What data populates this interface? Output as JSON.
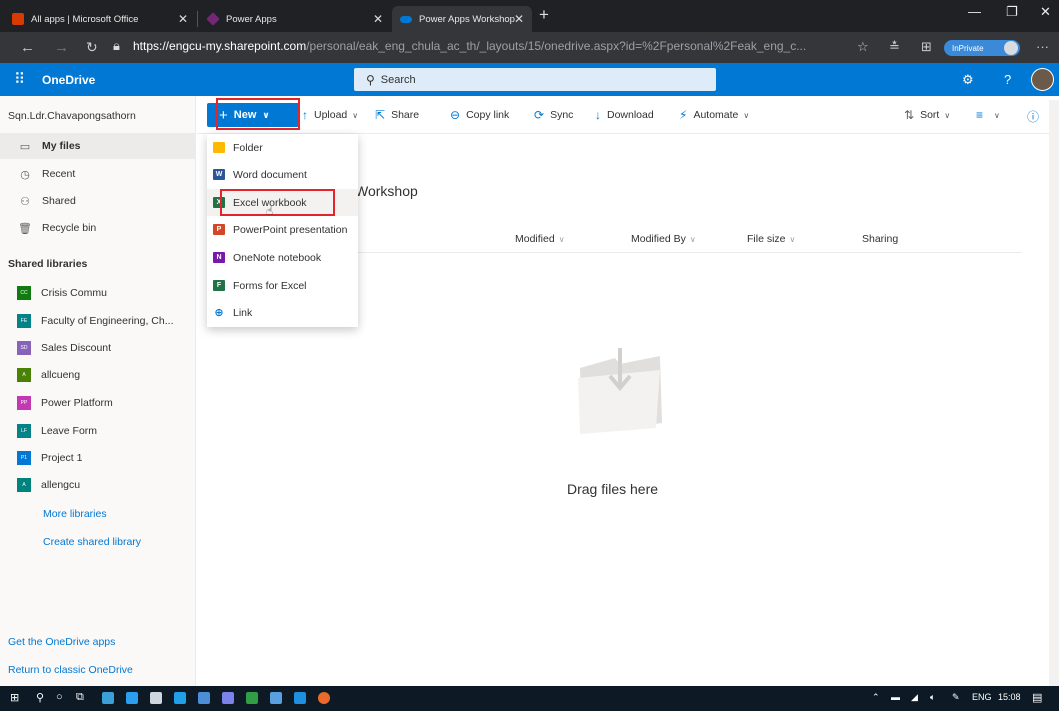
{
  "browser": {
    "tabs": [
      {
        "title": "All apps | Microsoft Office",
        "icon": "office-icon",
        "color": "#d83b01"
      },
      {
        "title": "Power Apps",
        "icon": "powerapps-icon",
        "color": "#742774"
      },
      {
        "title": "Power Apps Workshop - OneDri",
        "icon": "onedrive-icon",
        "color": "#0078d4"
      }
    ],
    "url_host": "https://engcu-my.sharepoint.com",
    "url_path": "/personal/eak_eng_chula_ac_th/_layouts/15/onedrive.aspx?id=%2Fpersonal%2Feak_eng_c...",
    "inprivate_label": "InPrivate"
  },
  "suite": {
    "app_name": "OneDrive",
    "search_placeholder": "Search"
  },
  "nav": {
    "user_name": "Sqn.Ldr.Chavapongsathorn",
    "items": [
      {
        "label": "My files",
        "icon": "folder-icon",
        "selected": true
      },
      {
        "label": "Recent",
        "icon": "clock-icon",
        "selected": false
      },
      {
        "label": "Shared",
        "icon": "people-icon",
        "selected": false
      },
      {
        "label": "Recycle bin",
        "icon": "recycle-bin-icon",
        "selected": false
      }
    ],
    "shared_libraries_header": "Shared libraries",
    "libraries": [
      {
        "label": "Crisis Commu",
        "badge": "CC",
        "color": "#107c10"
      },
      {
        "label": "Faculty of Engineering, Ch...",
        "badge": "FE",
        "color": "#038387"
      },
      {
        "label": "Sales Discount",
        "badge": "SD",
        "color": "#8764b8"
      },
      {
        "label": "allcueng",
        "badge": "A",
        "color": "#498205"
      },
      {
        "label": "Power Platform",
        "badge": "PP",
        "color": "#c239b3"
      },
      {
        "label": "Leave Form",
        "badge": "LF",
        "color": "#038387"
      },
      {
        "label": "Project 1",
        "badge": "P1",
        "color": "#0078d4"
      },
      {
        "label": "allengcu",
        "badge": "A",
        "color": "#00827d"
      }
    ],
    "more_libraries": "More libraries",
    "create_shared_library": "Create shared library",
    "get_apps": "Get the OneDrive apps",
    "return_classic": "Return to classic OneDrive"
  },
  "commandbar": {
    "new_label": "New",
    "upload": "Upload",
    "share": "Share",
    "copy_link": "Copy link",
    "sync": "Sync",
    "download": "Download",
    "automate": "Automate",
    "sort": "Sort"
  },
  "new_menu": {
    "items": [
      {
        "label": "Folder",
        "icon": "folder-icon",
        "color": "#ffb900"
      },
      {
        "label": "Word document",
        "icon": "word-icon",
        "color": "#2b579a"
      },
      {
        "label": "Excel workbook",
        "icon": "excel-icon",
        "color": "#217346"
      },
      {
        "label": "PowerPoint presentation",
        "icon": "powerpoint-icon",
        "color": "#d24726"
      },
      {
        "label": "OneNote notebook",
        "icon": "onenote-icon",
        "color": "#7719aa"
      },
      {
        "label": "Forms for Excel",
        "icon": "forms-icon",
        "color": "#217346"
      },
      {
        "label": "Link",
        "icon": "globe-icon",
        "color": "#0078d4"
      }
    ]
  },
  "content": {
    "folder_title": "Workshop",
    "columns": [
      "Modified",
      "Modified By",
      "File size",
      "Sharing"
    ],
    "empty_message": "Drag files here"
  },
  "taskbar": {
    "language": "ENG",
    "time": "15:08"
  },
  "colors": {
    "accent": "#0078d4",
    "highlight_box": "#e3242b"
  }
}
